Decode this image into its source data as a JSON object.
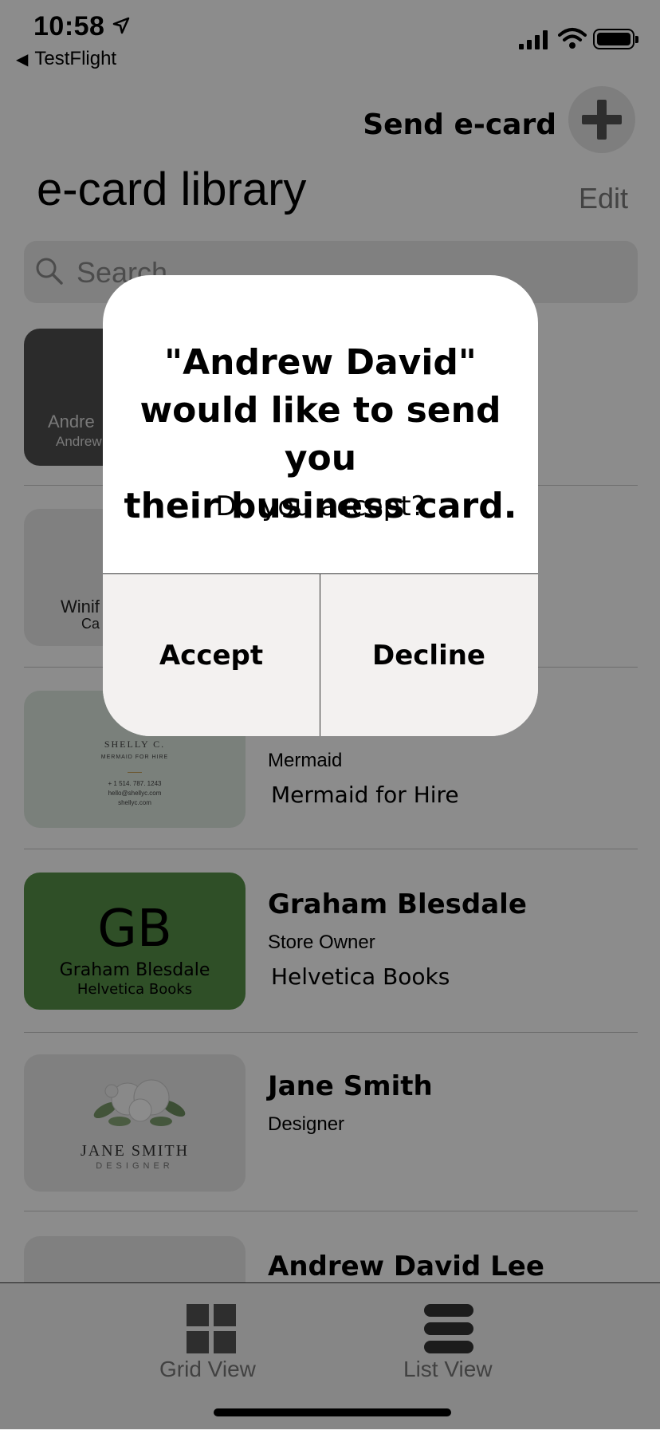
{
  "status_bar": {
    "time": "10:58",
    "back_app": "TestFlight"
  },
  "header": {
    "send_label": "Send e-card",
    "title": "e-card library",
    "edit_label": "Edit"
  },
  "search": {
    "placeholder": "Search"
  },
  "cards": [
    {
      "thumb_lines": [
        "A",
        "Andre",
        "Andrew"
      ],
      "name": "",
      "title": "",
      "company": ""
    },
    {
      "thumb_lines": [
        "Winif",
        "Ca"
      ],
      "name": "",
      "title": "",
      "company": ""
    },
    {
      "thumb_lines": [
        "SHELLY C.",
        "MERMAID FOR HIRE",
        "+ 1 514. 787. 1243",
        "hello@shellyc.com",
        "shellyc.com"
      ],
      "name": "",
      "title": "Mermaid",
      "company": "Mermaid for Hire"
    },
    {
      "thumb_lines": [
        "GB",
        "Graham Blesdale",
        "Helvetica Books"
      ],
      "name": "Graham Blesdale",
      "title": "Store Owner",
      "company": "Helvetica Books"
    },
    {
      "thumb_lines": [
        "JANE SMITH",
        "DESIGNER"
      ],
      "name": "Jane Smith",
      "title": "Designer",
      "company": ""
    },
    {
      "thumb_lines": [],
      "name": "Andrew David Lee",
      "title": "",
      "company": ""
    }
  ],
  "tabbar": {
    "grid_label": "Grid View",
    "list_label": "List View"
  },
  "alert": {
    "title_line1": "\"Andrew David\"",
    "title_line2": "would like to send you",
    "title_line3": "their business card.",
    "message": "Do you accept?",
    "accept_label": "Accept",
    "decline_label": "Decline"
  },
  "colors": {
    "dim_overlay": "#000000",
    "gb_card": "#569048",
    "card_dark": "#4f4f4f",
    "mermaid_card": "#dfe9e1"
  }
}
